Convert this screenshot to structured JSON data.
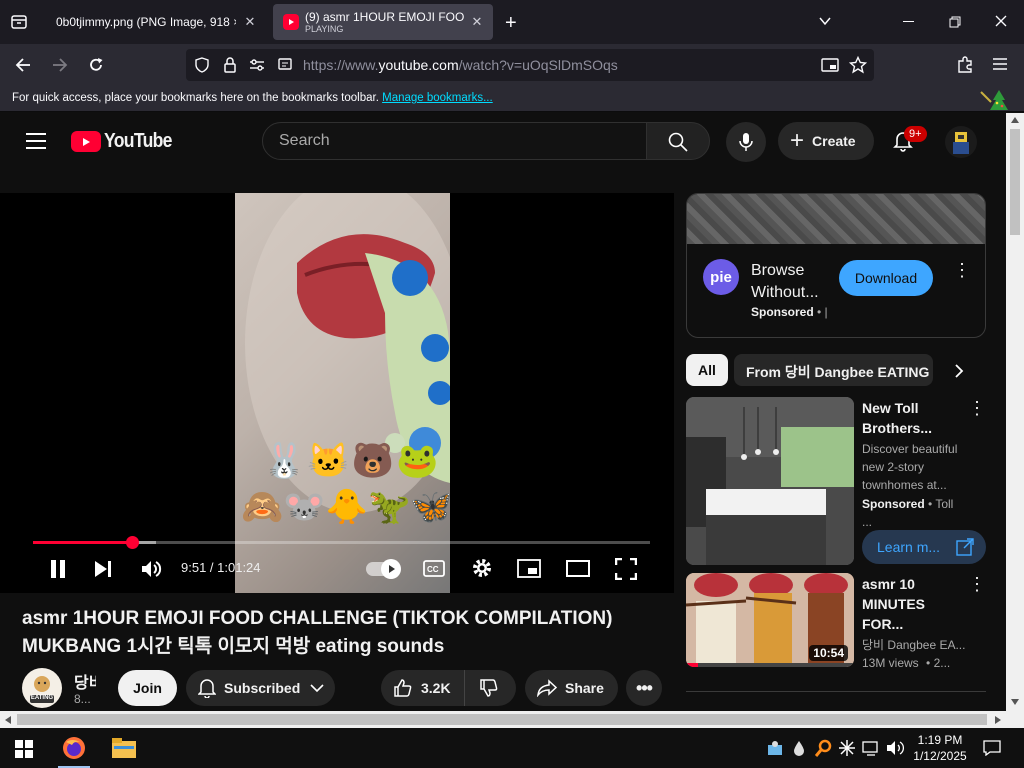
{
  "browser": {
    "tabs": [
      {
        "label": "0b0tjimmy.png (PNG Image, 918 ×",
        "active": false
      },
      {
        "label": "(9) asmr 1HOUR EMOJI FOOD C",
        "sublabel": "PLAYING",
        "active": true
      }
    ],
    "url_prefix": "https://www.",
    "url_domain": "youtube.com",
    "url_path": "/watch?v=uOqSlDmSOqs",
    "bookmarks_text": "For quick access, place your bookmarks here on the bookmarks toolbar.",
    "bookmarks_link": "Manage bookmarks..."
  },
  "youtube": {
    "logo_text": "YouTube",
    "search_placeholder": "Search",
    "create_label": "Create",
    "notif_count": "9+",
    "player": {
      "time": "9:51 / 1:01:24",
      "progress_fraction": 0.161,
      "emojis_row1": "🐰🐱🐻🐸",
      "emojis_row2": "🙈🐭🐥🦖🦋"
    },
    "video_title_line1": "asmr 1HOUR EMOJI FOOD CHALLENGE (TIKTOK COMPILATION)",
    "video_title_line2": "MUKBANG 1시간 틱톡 이모지 먹방 eating sounds",
    "channel": {
      "name": "당비",
      "subs": "8...",
      "avatar_text": "EATING"
    },
    "join_label": "Join",
    "subscribed_label": "Subscribed",
    "likes": "3.2K",
    "share_label": "Share",
    "ad": {
      "logo": "pie",
      "title_line1": "Browse",
      "title_line2": "Without...",
      "sponsored": "Sponsored",
      "sponsored_sep": "• |",
      "button": "Download"
    },
    "chips": [
      "All",
      "From 당비 Dangbee EATING"
    ],
    "sidebar": [
      {
        "title_line1": "New Toll",
        "title_line2": "Brothers...",
        "desc_line1": "Discover beautiful",
        "desc_line2": "new 2-story",
        "desc_line3": "townhomes at...",
        "sponsored": "Sponsored",
        "sponsor_name": "• Toll ...",
        "cta": "Learn m..."
      },
      {
        "title_line1": "asmr 10",
        "title_line2": "MINUTES FOR...",
        "channel": "당비 Dangbee EA...",
        "views": "13M views",
        "age": "• 2...",
        "duration": "10:54"
      }
    ]
  },
  "taskbar": {
    "time": "1:19 PM",
    "date": "1/12/2025"
  },
  "colors": {
    "yt_red": "#ff0033",
    "accent_blue": "#3ea6ff",
    "link_blue": "#00ddff"
  }
}
